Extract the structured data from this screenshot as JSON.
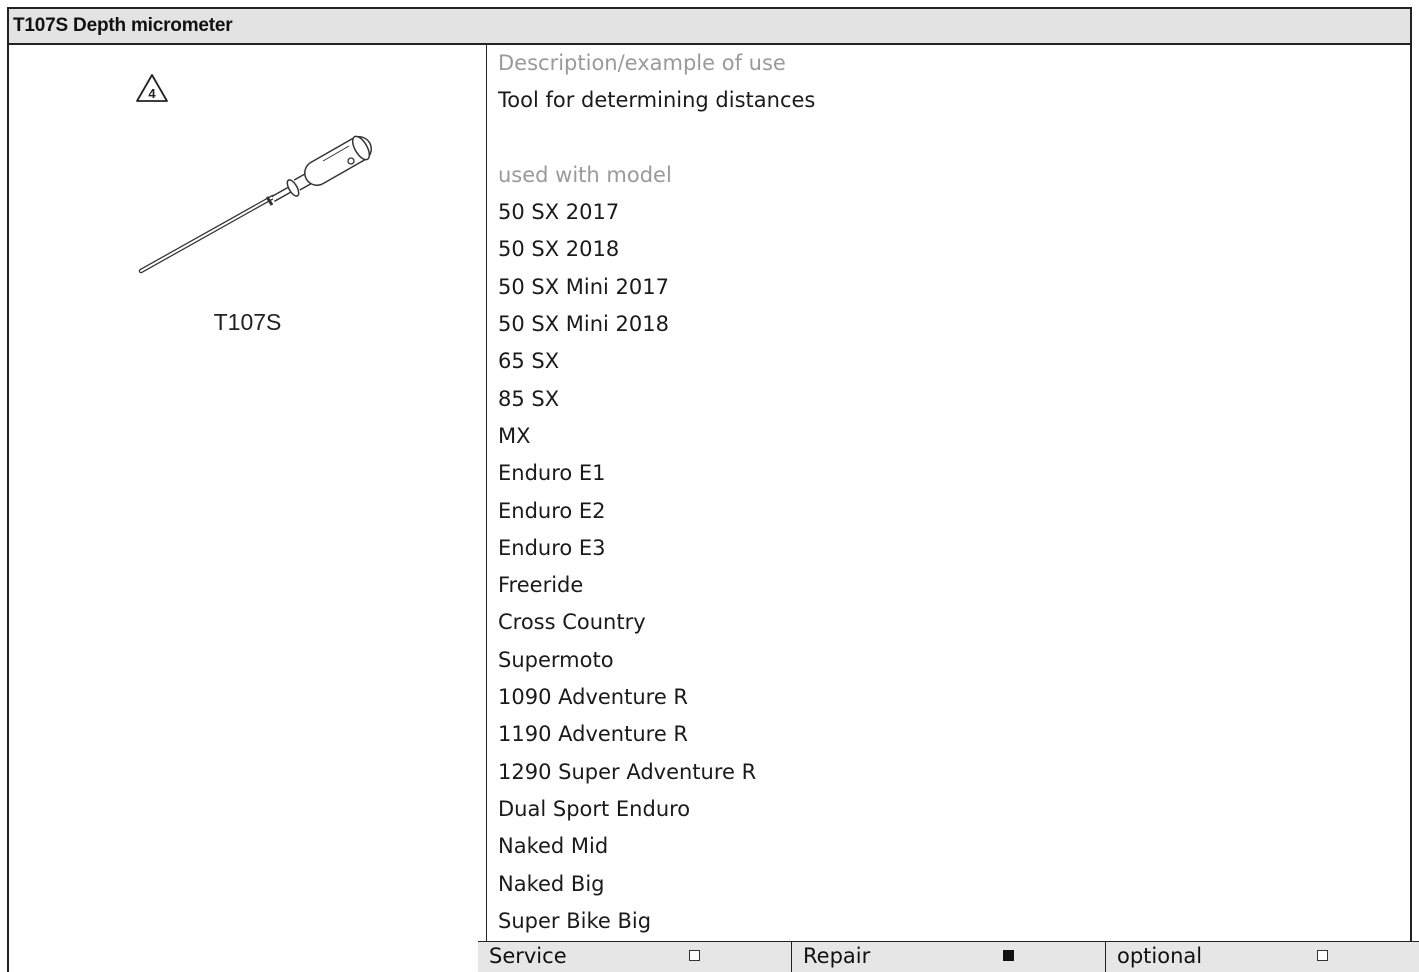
{
  "title": "T107S Depth micrometer",
  "tool": {
    "warning_icon_number": "4",
    "caption": "T107S"
  },
  "description": {
    "label": "Description/example of use",
    "text": "Tool for determining distances"
  },
  "models": {
    "label": "used with model",
    "items": [
      "50 SX 2017",
      "50 SX 2018",
      "50 SX Mini 2017",
      "50 SX Mini 2018",
      "65 SX",
      "85 SX",
      "MX",
      "Enduro E1",
      "Enduro E2",
      "Enduro E3",
      "Freeride",
      "Cross Country",
      "Supermoto",
      "1090 Adventure R",
      "1190 Adventure R",
      "1290 Super Adventure R",
      "Dual Sport Enduro",
      "Naked Mid",
      "Naked Big",
      "Super Bike Big"
    ]
  },
  "footer": [
    {
      "label": "Service",
      "checked": false
    },
    {
      "label": "Repair",
      "checked": true
    },
    {
      "label": "optional",
      "checked": false
    }
  ],
  "colors": {
    "header_bg": "#e3e3e3",
    "label_grey": "#9a9a9a",
    "footer_bg": "#e6e6e6"
  }
}
